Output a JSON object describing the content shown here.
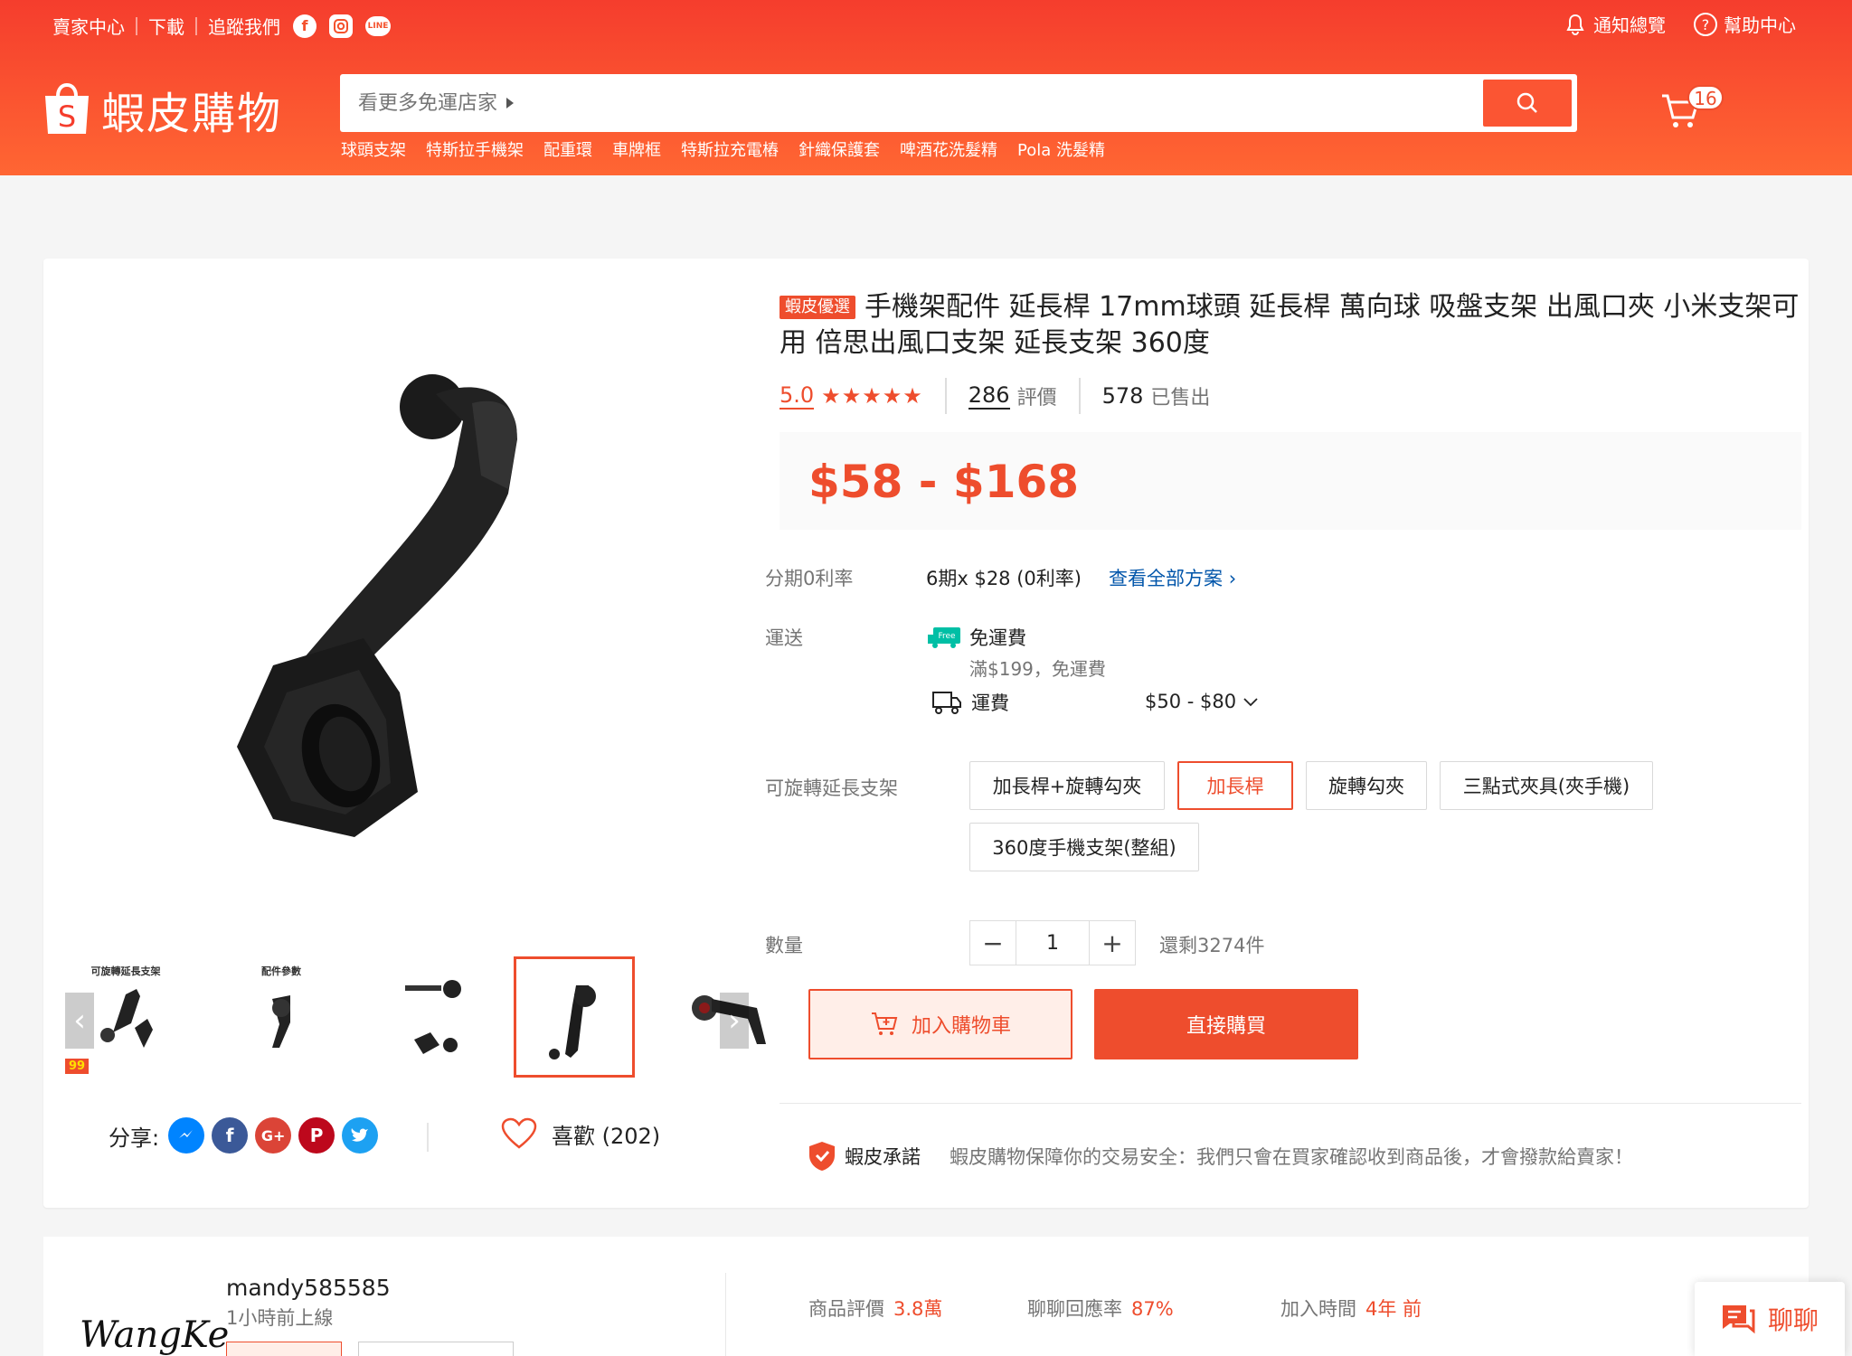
{
  "topbar": {
    "seller_center": "賣家中心",
    "download": "下載",
    "follow_us": "追蹤我們",
    "notifications": "通知總覽",
    "help": "幫助中心"
  },
  "brand": {
    "name": "蝦皮購物",
    "color": "#ee4d2d"
  },
  "search": {
    "placeholder": "看更多免運店家",
    "hotwords": [
      "球頭支架",
      "特斯拉手機架",
      "配重環",
      "車牌框",
      "特斯拉充電樁",
      "針織保護套",
      "啤酒花洗髮精",
      "Pola 洗髮精"
    ]
  },
  "cart": {
    "count": "16"
  },
  "product": {
    "badge": "蝦皮優選",
    "title": "手機架配件 延長桿 17mm球頭 延長桿 萬向球 吸盤支架 出風口夾 小米支架可用 倍思出風口支架 延長支架 360度",
    "rating": "5.0",
    "stars": 5,
    "review_count": "286",
    "review_label": "評價",
    "sold_count": "578",
    "sold_label": "已售出",
    "price": "$58 - $168"
  },
  "gallery": {
    "thumb_captions": [
      "可旋轉延長支架",
      "配件參數"
    ],
    "thumb_promo": "99"
  },
  "installment": {
    "label": "分期0利率",
    "value": "6期x $28 (0利率)",
    "link": "查看全部方案"
  },
  "shipping": {
    "label": "運送",
    "free_title": "免運費",
    "free_desc": "滿$199，免運費",
    "fee_label": "運費",
    "fee_range": "$50 - $80",
    "free_badge": "Free"
  },
  "variation": {
    "label": "可旋轉延長支架",
    "options": [
      "加長桿+旋轉勾夾",
      "加長桿",
      "旋轉勾夾",
      "三點式夾具(夾手機)",
      "360度手機支架(整組)"
    ],
    "selected": "加長桿"
  },
  "quantity": {
    "label": "數量",
    "value": "1",
    "stock": "還剩3274件",
    "minus": "−",
    "plus": "+"
  },
  "actions": {
    "add_to_cart": "加入購物車",
    "buy_now": "直接購買"
  },
  "share": {
    "label": "分享:",
    "likes": "喜歡 (202)"
  },
  "guarantee": {
    "title": "蝦皮承諾",
    "desc": "蝦皮購物保障你的交易安全：我們只會在買家確認收到商品後，才會撥款給賣家！"
  },
  "shop": {
    "logo_text": "WangKe",
    "name": "mandy585585",
    "online": "1小時前上線",
    "stats": [
      {
        "label": "商品評價",
        "value": "3.8萬"
      },
      {
        "label": "聊聊回應率",
        "value": "87%"
      },
      {
        "label": "加入時間",
        "value": "4年 前"
      }
    ]
  },
  "chat": {
    "label": "聊聊"
  }
}
